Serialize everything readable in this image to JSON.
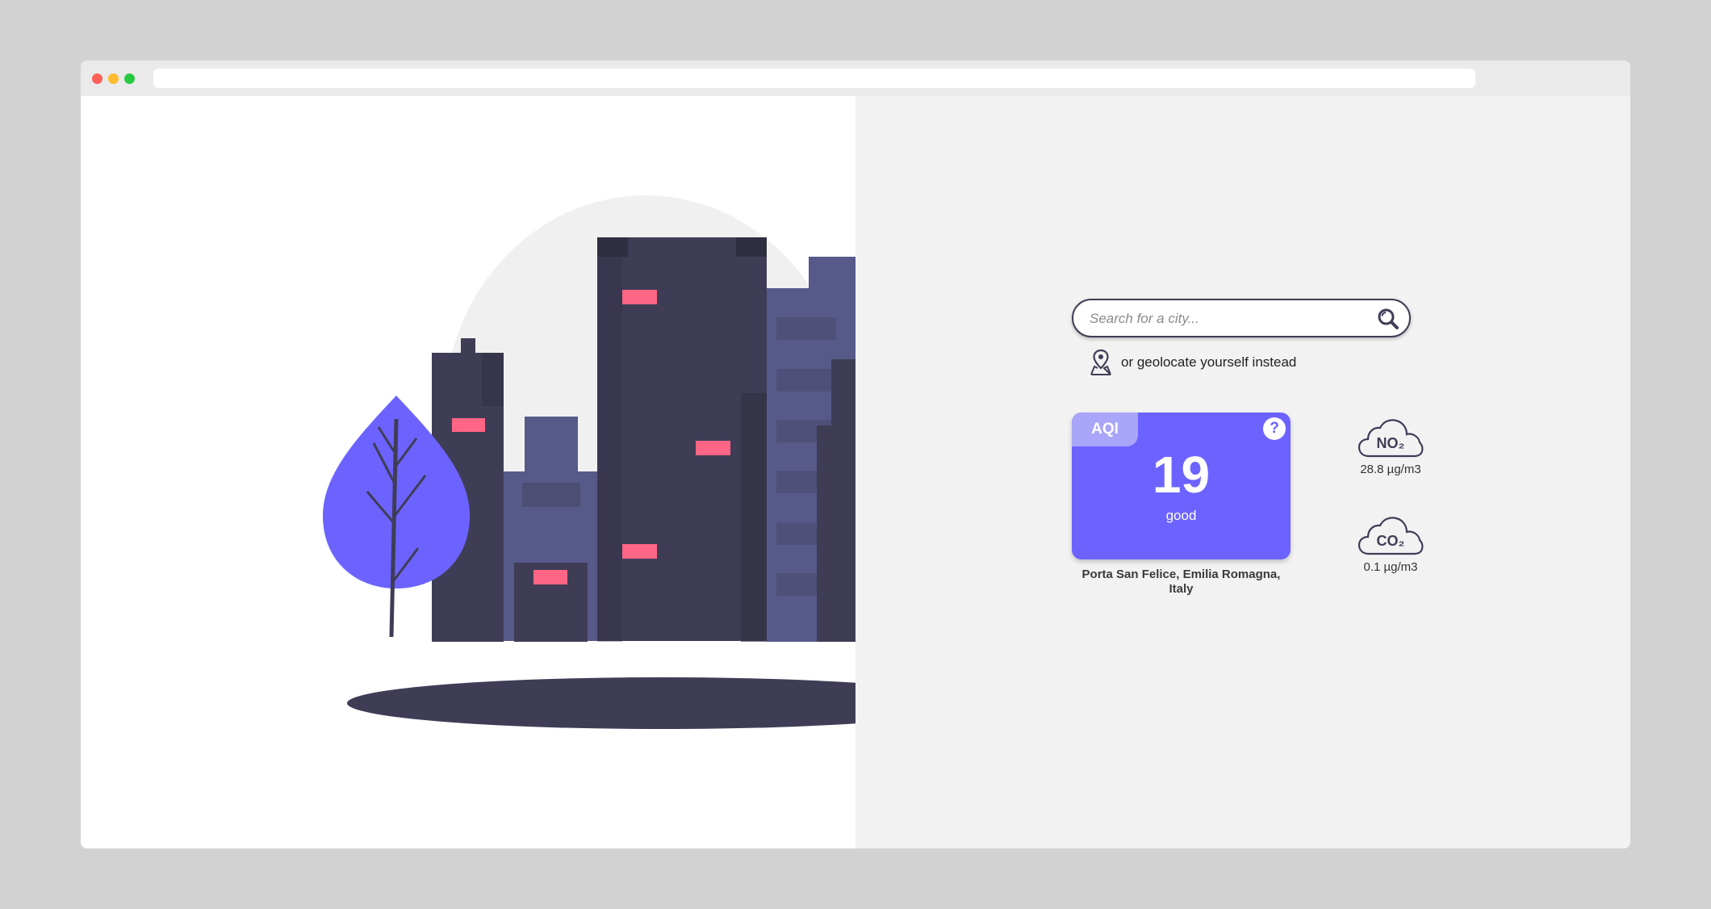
{
  "search": {
    "placeholder": "Search for a city..."
  },
  "geolocate": {
    "label": "or geolocate yourself instead",
    "icon": "map-pin-icon"
  },
  "aqi": {
    "tag": "AQI",
    "help": "?",
    "value": "19",
    "label": "good"
  },
  "location": "Porta San Felice, Emilia Romagna, Italy",
  "pollutants": [
    {
      "name": "NO₂",
      "value": "28.8 µg/m3",
      "icon": "cloud-icon"
    },
    {
      "name": "CO₂",
      "value": "0.1 µg/m3",
      "icon": "cloud-icon"
    }
  ],
  "colors": {
    "accent": "#6c63ff",
    "tag": "#a9a5f8",
    "building_dark": "#3f3d56",
    "building_light": "#575a89",
    "window": "#ff6584",
    "panel_bg": "#f2f2f2"
  }
}
